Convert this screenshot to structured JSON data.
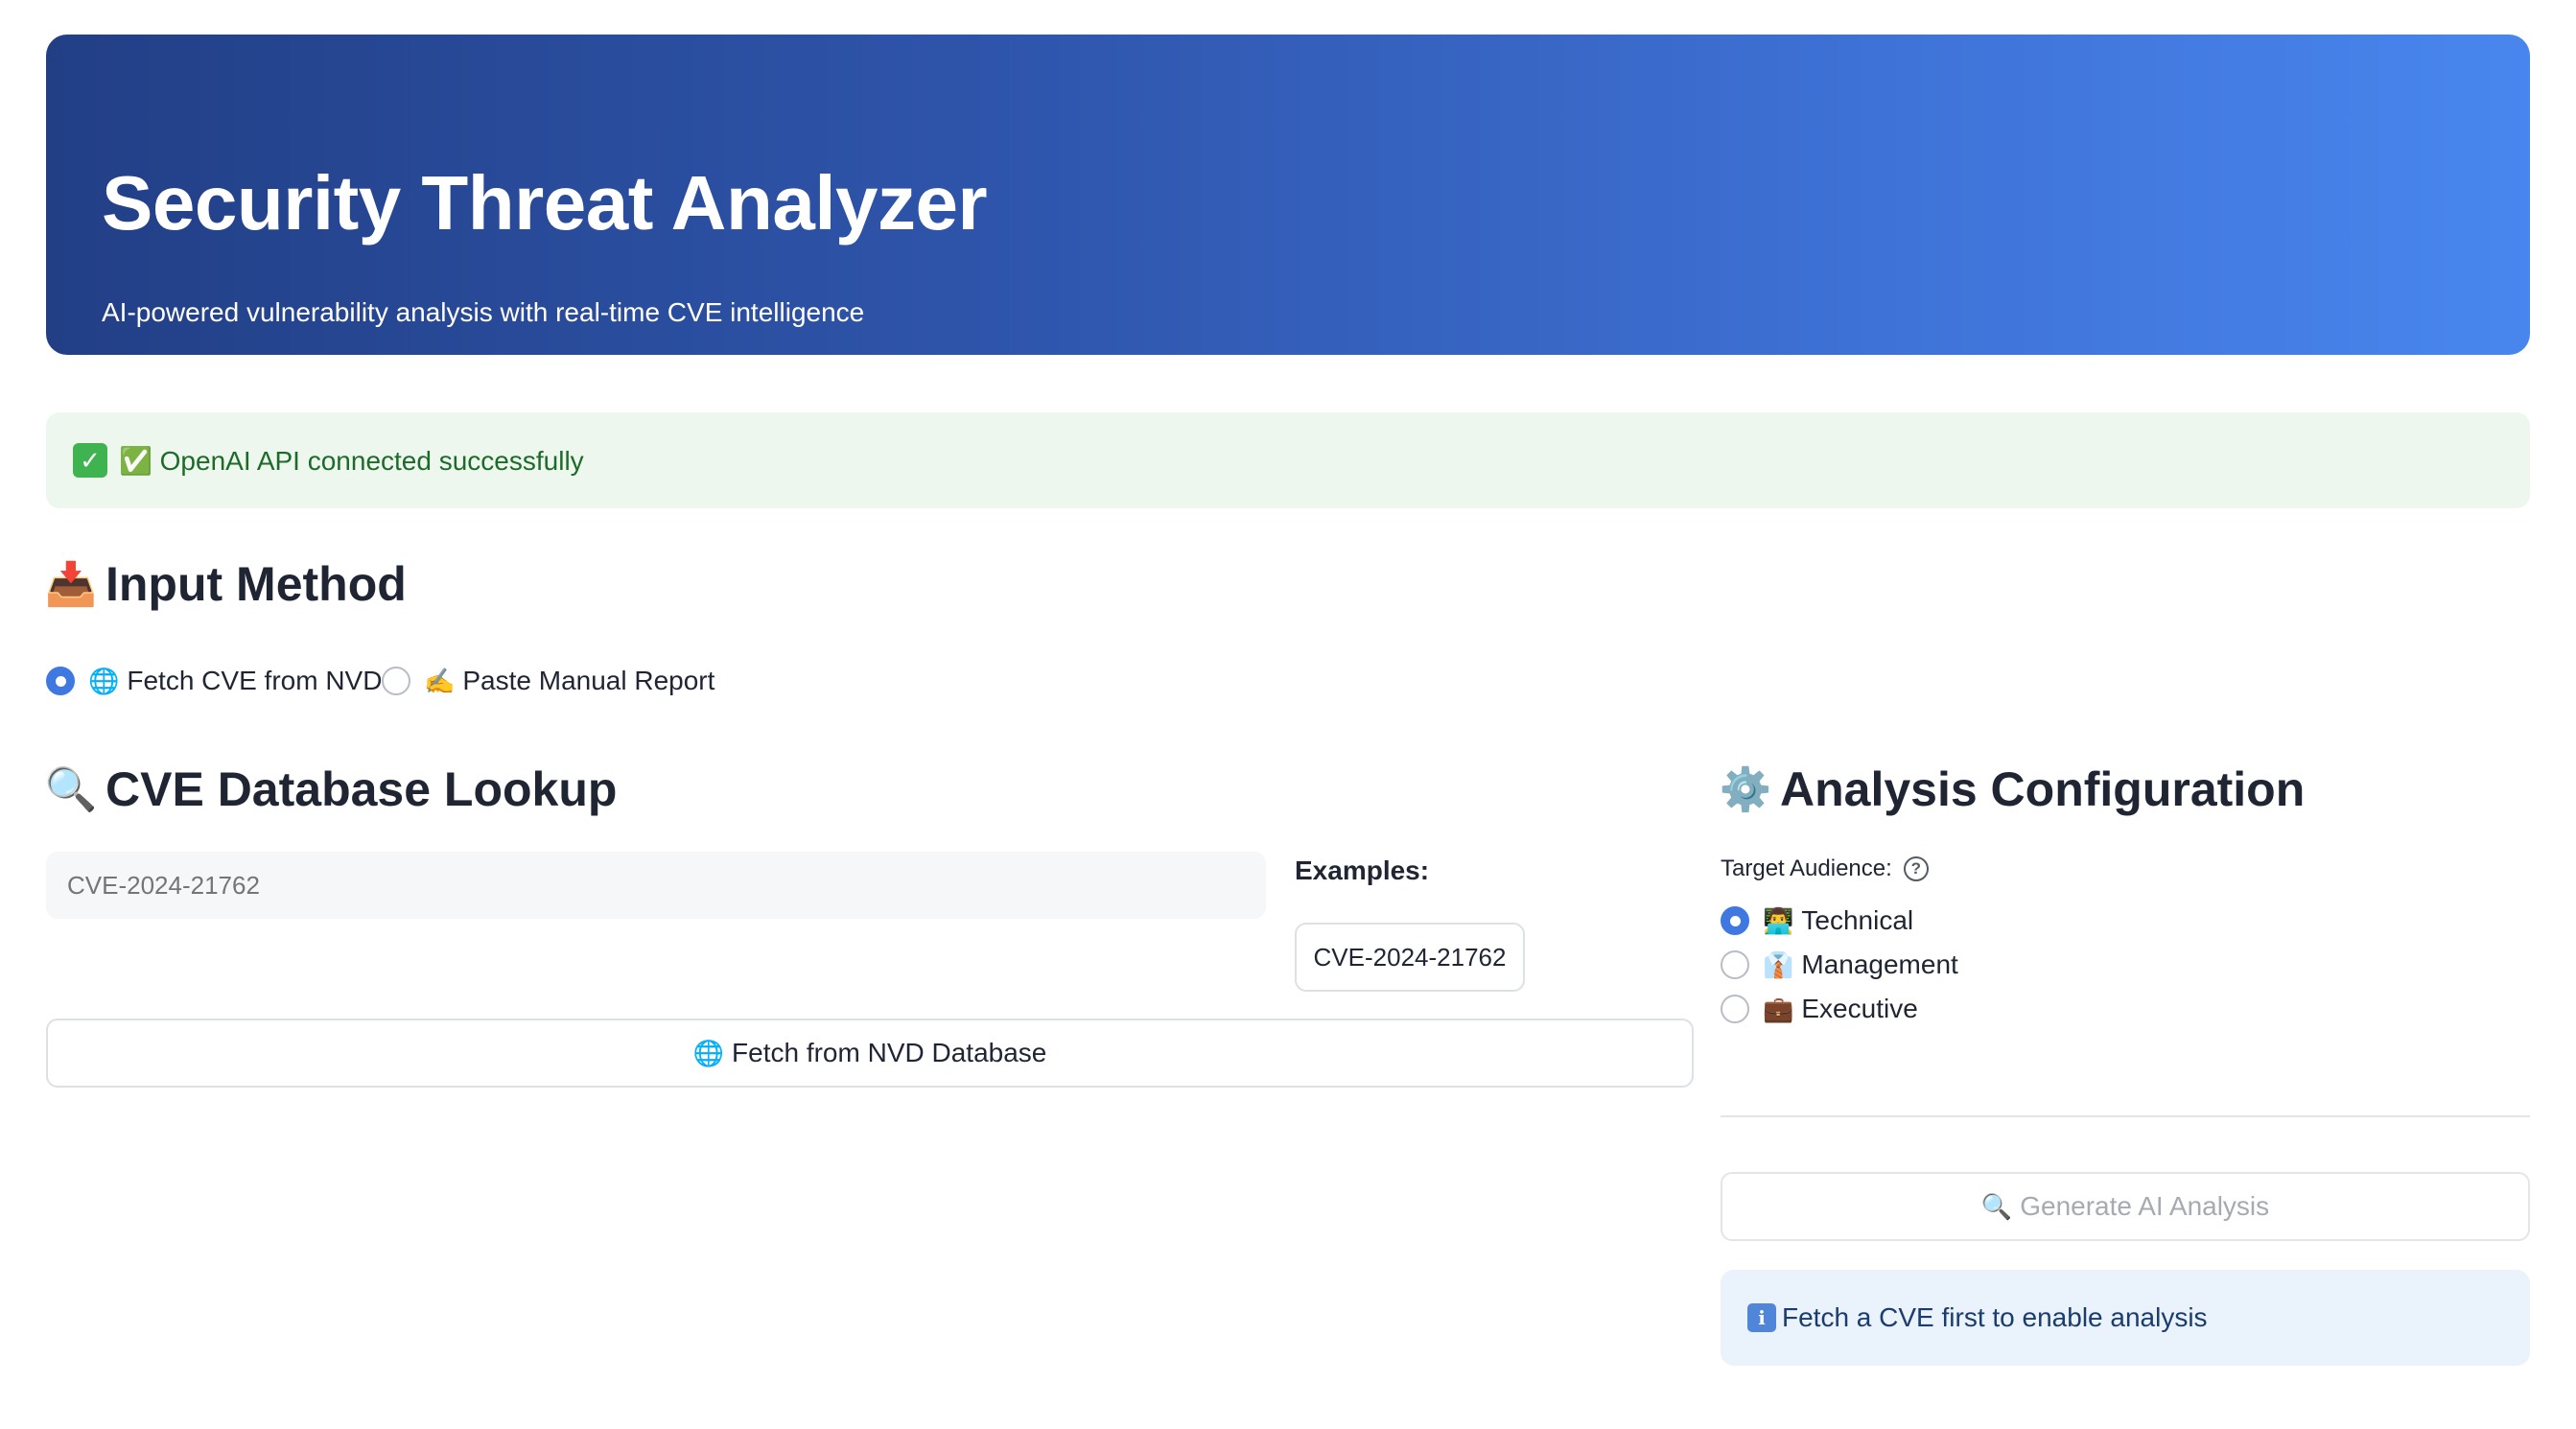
{
  "header": {
    "title": "Security Threat Analyzer",
    "subtitle": "AI-powered vulnerability analysis with real-time CVE intelligence"
  },
  "status_alert": {
    "icon": "check-mark-icon",
    "text": "✅ OpenAI API connected successfully"
  },
  "input_method": {
    "title": "Input Method",
    "icon": "inbox-tray-icon",
    "options": [
      {
        "label": "Fetch CVE from NVD",
        "icon": "globe-icon",
        "selected": true
      },
      {
        "label": "Paste Manual Report",
        "icon": "writing-hand-icon",
        "selected": false
      }
    ]
  },
  "cve_lookup": {
    "title": "CVE Database Lookup",
    "icon": "magnifier-icon",
    "input_placeholder": "CVE-2024-21762",
    "examples_label": "Examples:",
    "example_value": "CVE-2024-21762",
    "fetch_button_label": "Fetch from NVD Database"
  },
  "analysis_config": {
    "title": "Analysis Configuration",
    "icon": "gear-icon",
    "target_label": "Target Audience:",
    "audiences": [
      {
        "label": "Technical",
        "icon": "technologist-icon",
        "selected": true
      },
      {
        "label": "Management",
        "icon": "office-worker-icon",
        "selected": false
      },
      {
        "label": "Executive",
        "icon": "briefcase-icon",
        "selected": false
      }
    ],
    "generate_button_label": "Generate AI Analysis",
    "info_text": "Fetch a CVE first to enable analysis"
  },
  "colors": {
    "header_start": "#223f86",
    "header_end": "#4886ee",
    "success_bg": "#eef7ee",
    "info_bg": "#eaf2fb",
    "accent": "#3f78e0"
  }
}
